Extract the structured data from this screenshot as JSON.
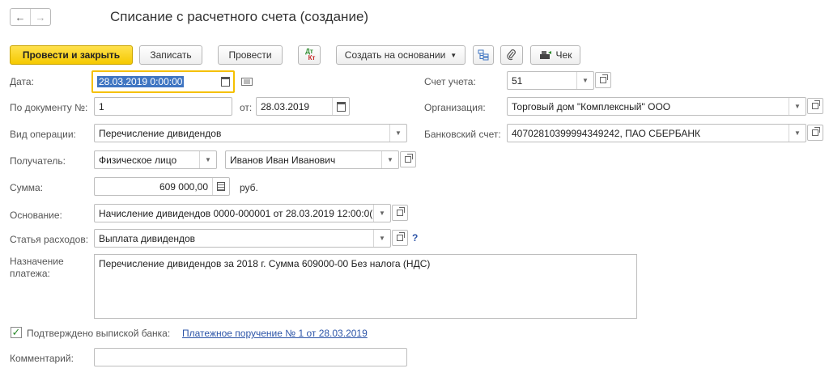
{
  "header": {
    "back_glyph": "←",
    "forward_glyph": "→",
    "title": "Списание с расчетного счета (создание)"
  },
  "toolbar": {
    "post_close": "Провести и закрыть",
    "write": "Записать",
    "post": "Провести",
    "dtkt_top": "Дт",
    "dtkt_bottom": "Кт",
    "create_based": "Создать на основании",
    "receipt": "Чек"
  },
  "form": {
    "date_label": "Дата:",
    "date_value": "28.03.2019  0:00:00",
    "doc_no_label": "По документу №:",
    "doc_no_value": "1",
    "from_label": "от:",
    "from_value": "28.03.2019",
    "op_type_label": "Вид операции:",
    "op_type_value": "Перечисление дивидендов",
    "recipient_label": "Получатель:",
    "recipient_type": "Физическое лицо",
    "recipient_name": "Иванов Иван Иванович",
    "sum_label": "Сумма:",
    "sum_value": "609 000,00",
    "currency": "руб.",
    "basis_label": "Основание:",
    "basis_value": "Начисление дивидендов 0000-000001 от 28.03.2019 12:00:0(",
    "expense_label": "Статья расходов:",
    "expense_value": "Выплата дивидендов",
    "help_glyph": "?",
    "purpose_label_1": "Назначение",
    "purpose_label_2": "платежа:",
    "purpose_value": "Перечисление дивидендов за 2018 г. Сумма 609000-00 Без налога (НДС)",
    "confirmed_label": "Подтверждено выпиской банка:",
    "confirmed_link": "Платежное поручение № 1 от 28.03.2019",
    "comment_label": "Комментарий:",
    "comment_value": "",
    "account_label": "Счет учета:",
    "account_value": "51",
    "org_label": "Организация:",
    "org_value": "Торговый дом \"Комплексный\" ООО",
    "bank_label": "Банковский счет:",
    "bank_value": "40702810399994349242, ПАО СБЕРБАНК"
  }
}
